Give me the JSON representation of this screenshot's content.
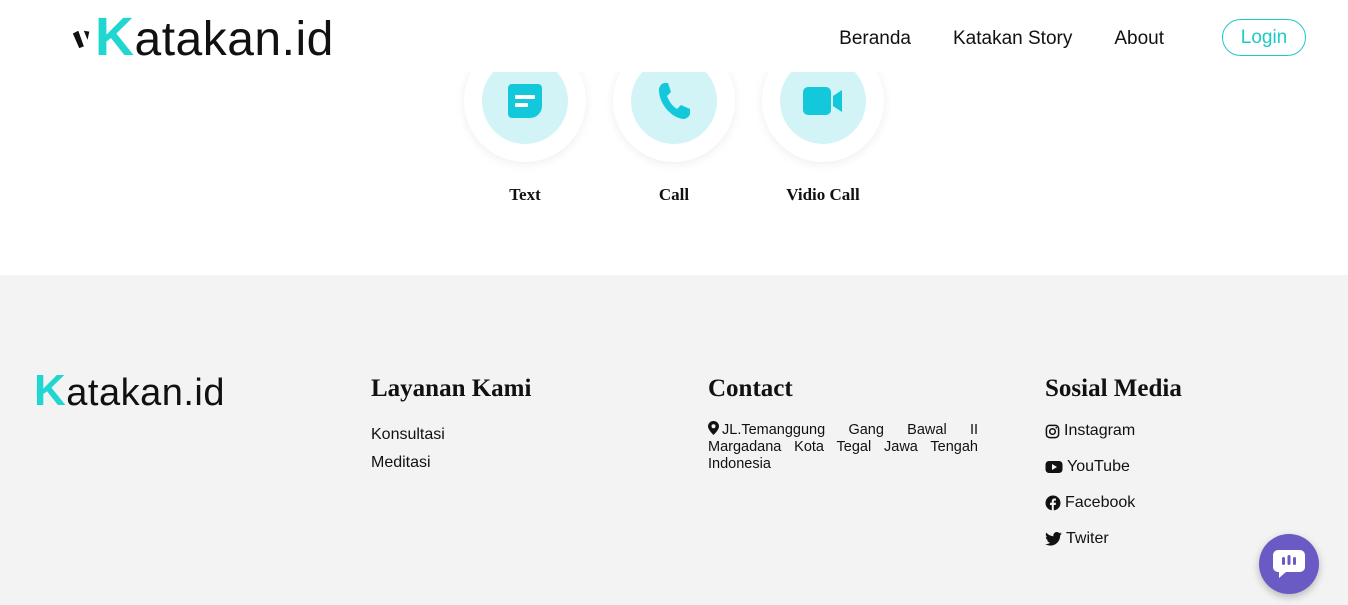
{
  "header": {
    "logo_text": "atakan.id",
    "logo_letter": "K",
    "nav": [
      {
        "label": "Beranda"
      },
      {
        "label": "Katakan Story"
      },
      {
        "label": "About"
      }
    ],
    "login_label": "Login"
  },
  "services": [
    {
      "label": "Text",
      "icon": "message-icon"
    },
    {
      "label": "Call",
      "icon": "phone-icon"
    },
    {
      "label": "Vidio Call",
      "icon": "video-icon"
    }
  ],
  "footer": {
    "logo_letter": "K",
    "logo_text": "atakan.id",
    "layanan": {
      "heading": "Layanan Kami",
      "items": [
        "Konsultasi",
        "Meditasi"
      ]
    },
    "contact": {
      "heading": "Contact",
      "address": "JL.Temanggung Gang Bawal II Margadana Kota Tegal Jawa Tengah Indonesia"
    },
    "social": {
      "heading": "Sosial Media",
      "items": [
        {
          "label": "Instagram",
          "icon": "instagram-icon"
        },
        {
          "label": "YouTube",
          "icon": "youtube-icon"
        },
        {
          "label": "Facebook",
          "icon": "facebook-icon"
        },
        {
          "label": "Twiter",
          "icon": "twitter-icon"
        }
      ]
    }
  },
  "colors": {
    "accent": "#1fd6d0",
    "service_bg": "#d2f4f7",
    "service_icon": "#14c8dc",
    "footer_bg": "#f3f3f3",
    "chat_fab": "#6a5bc4"
  }
}
